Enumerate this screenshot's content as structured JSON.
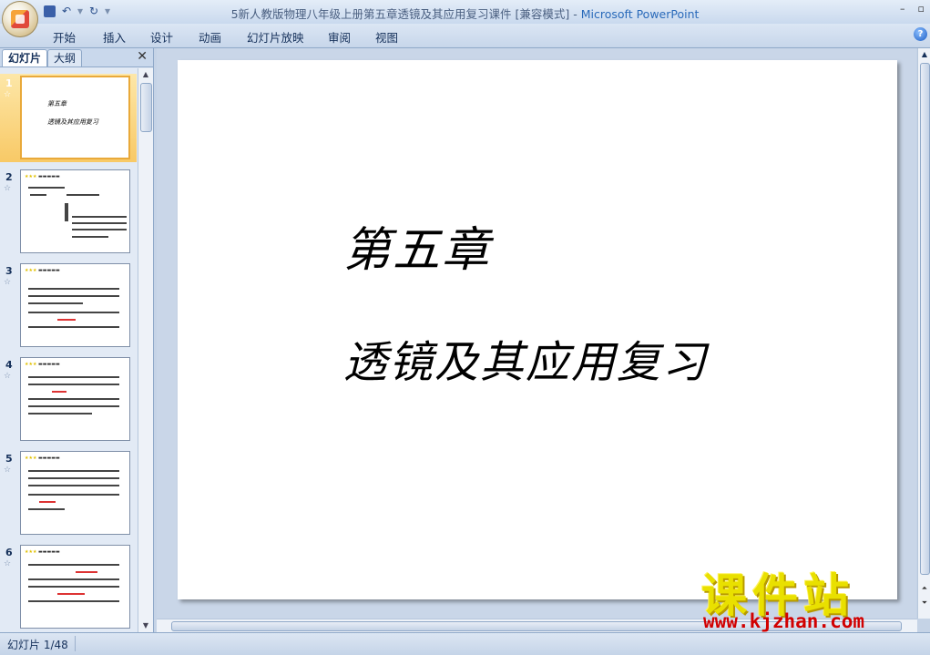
{
  "titlebar": {
    "doc_title": "5新人教版物理八年级上册第五章透镜及其应用复习课件 [兼容模式]",
    "separator": " - ",
    "app_name": "Microsoft PowerPoint"
  },
  "ribbon": {
    "tabs": [
      "开始",
      "插入",
      "设计",
      "动画",
      "幻灯片放映",
      "审阅",
      "视图"
    ]
  },
  "left_pane": {
    "tab_slides": "幻灯片",
    "tab_outline": "大纲",
    "thumbnails": [
      {
        "num": "1",
        "selected": true,
        "line1": "第五章",
        "line2": "透镜及其应用复习"
      },
      {
        "num": "2",
        "selected": false
      },
      {
        "num": "3",
        "selected": false
      },
      {
        "num": "4",
        "selected": false
      },
      {
        "num": "5",
        "selected": false
      },
      {
        "num": "6",
        "selected": false
      }
    ]
  },
  "slide": {
    "title": "第五章",
    "subtitle": "透镜及其应用复习"
  },
  "watermark": {
    "big": "课件站",
    "url": "www.kjzhan.com"
  },
  "statusbar": {
    "slide_info": "幻灯片 1/48"
  },
  "icons": [
    "office-button-icon",
    "save-icon",
    "undo-icon",
    "redo-icon",
    "customize-qat-icon",
    "minimize-icon",
    "maximize-icon",
    "help-icon",
    "close-pane-icon",
    "slide-transition-icon"
  ]
}
